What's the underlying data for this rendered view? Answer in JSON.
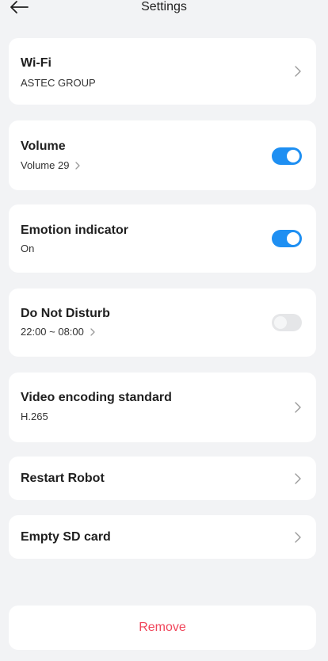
{
  "header": {
    "title": "Settings",
    "back_icon": "arrow-left-icon"
  },
  "wifi": {
    "title": "Wi-Fi",
    "network": "ASTEC GROUP"
  },
  "volume": {
    "title": "Volume",
    "value": "Volume 29",
    "enabled": true
  },
  "emotion": {
    "title": "Emotion indicator",
    "status": "On",
    "enabled": true
  },
  "dnd": {
    "title": "Do Not Disturb",
    "schedule": "22:00 ~ 08:00",
    "enabled": false
  },
  "video": {
    "title": "Video encoding standard",
    "value": "H.265"
  },
  "restart": {
    "title": "Restart Robot"
  },
  "sdcard": {
    "title": "Empty SD card"
  },
  "remove": {
    "label": "Remove"
  },
  "colors": {
    "accent": "#1e8ff2",
    "danger": "#f0455a",
    "background": "#f2f3f5",
    "card": "#ffffff"
  }
}
